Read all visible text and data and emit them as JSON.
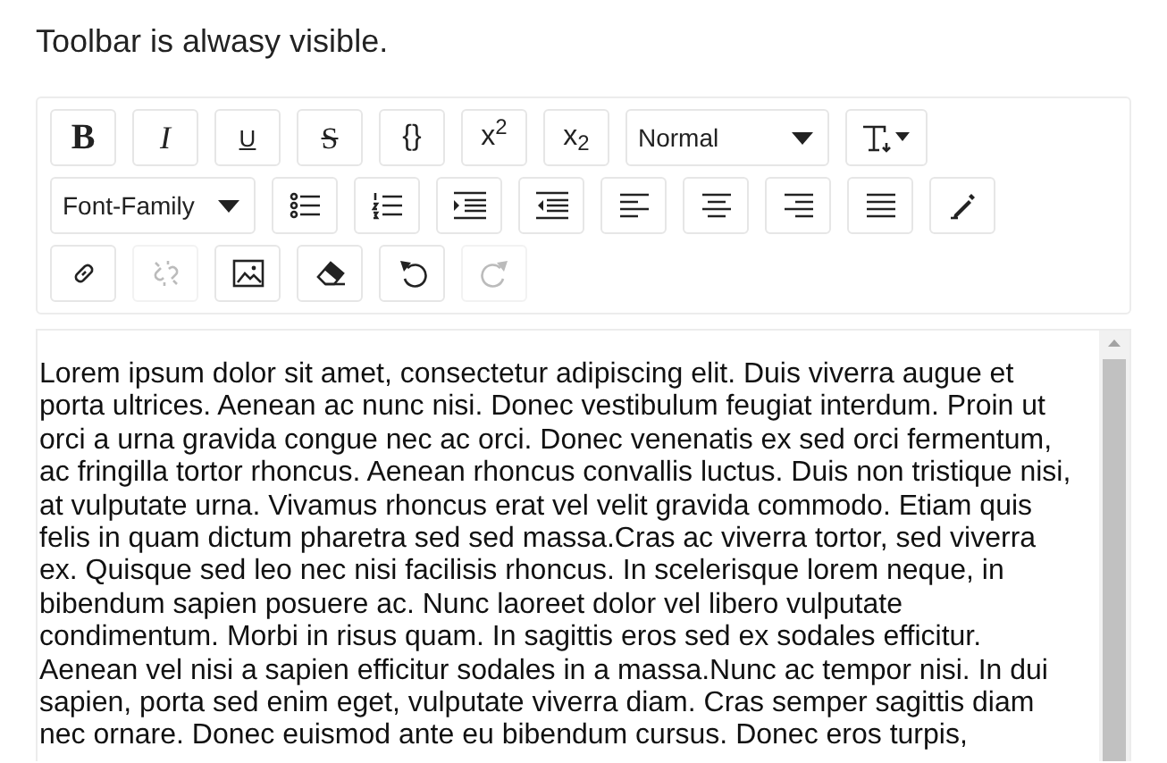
{
  "heading": "Toolbar is alwasy visible.",
  "toolbar": {
    "rows": [
      [
        {
          "kind": "bold",
          "label": "B",
          "disabled": false
        },
        {
          "kind": "italic",
          "label": "I",
          "disabled": false
        },
        {
          "kind": "underline",
          "label": "U",
          "disabled": false
        },
        {
          "kind": "strike",
          "label": "S",
          "disabled": false
        },
        {
          "kind": "plain",
          "label": "{}",
          "disabled": false
        },
        {
          "kind": "plain",
          "label": "x$^{2}$",
          "disabled": false
        },
        {
          "kind": "plain",
          "label": "x$_{2}$",
          "disabled": false
        },
        {
          "kind": "select",
          "label": "Normal"
        },
        {
          "kind": "icondrop",
          "disabled": false
        }
      ],
      [
        {
          "kind": "select",
          "label": "Font-Family"
        },
        {
          "kind": "icon",
          "disabled": false
        },
        {
          "kind": "icon",
          "disabled": false
        },
        {
          "kind": "icon",
          "disabled": false
        },
        {
          "kind": "icon",
          "disabled": false
        },
        {
          "kind": "icon",
          "disabled": false
        },
        {
          "kind": "icon",
          "disabled": false
        },
        {
          "kind": "icon",
          "disabled": false
        },
        {
          "kind": "icon",
          "disabled": false
        },
        {
          "kind": "icon",
          "disabled": false
        }
      ],
      [
        {
          "kind": "icon",
          "disabled": false
        },
        {
          "kind": "icon",
          "disabled": true
        },
        {
          "kind": "icon",
          "disabled": false
        },
        {
          "kind": "icon",
          "disabled": false
        },
        {
          "kind": "icon",
          "disabled": false
        },
        {
          "kind": "icon",
          "disabled": true
        }
      ]
    ]
  },
  "editor": {
    "lines": [
      " Lorem ipsum dolor sit amet, consectetur adipiscing elit. Duis viverra augue et",
      "porta ultrices. Aenean ac nunc nisi. Donec vestibulum feugiat interdum. Proin ut",
      "orci a urna gravida congue nec ac orci. Donec venenatis ex sed orci fermentum,",
      "ac fringilla tortor rhoncus. Aenean rhoncus convallis luctus. Duis non tristique nisi,",
      "at vulputate urna. Vivamus rhoncus erat vel velit gravida commodo. Etiam quis",
      "felis in quam dictum pharetra sed sed massa.Cras ac viverra tortor, sed viverra",
      "ex. Quisque sed leo nec nisi facilisis rhoncus. In scelerisque lorem neque, in",
      "bibendum sapien posuere ac. Nunc laoreet dolor vel libero vulputate",
      "condimentum. Morbi in risus quam. In sagittis eros sed ex sodales efficitur.",
      "Aenean vel nisi a sapien efficitur sodales in a massa.Nunc ac tempor nisi. In dui",
      "sapien, porta sed enim eget, vulputate viverra diam. Cras semper sagittis diam",
      "nec ornare. Donec euismod ante eu bibendum cursus. Donec eros turpis,"
    ]
  }
}
